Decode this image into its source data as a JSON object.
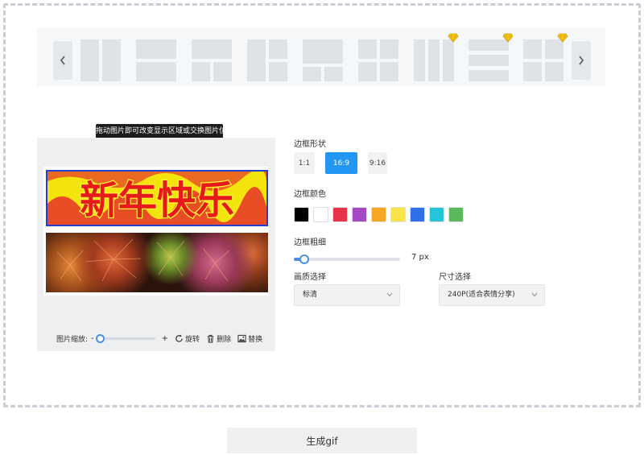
{
  "tooltip": "拖动图片即可改变显示区域或交换图片位置",
  "layouts": [
    {
      "id": "two-vertical",
      "vip": false
    },
    {
      "id": "two-horizontal",
      "vip": false
    },
    {
      "id": "one-top-two-bottom",
      "vip": false
    },
    {
      "id": "left-one-right-two",
      "vip": false
    },
    {
      "id": "top-one-bottom-two-wide",
      "vip": false
    },
    {
      "id": "top-two-bottom-one",
      "vip": false
    },
    {
      "id": "three-columns",
      "vip": true
    },
    {
      "id": "three-rows",
      "vip": true
    },
    {
      "id": "four-grid",
      "vip": true
    }
  ],
  "preview": {
    "banner_text": "新年快乐",
    "zoom_label": "图片缩放:",
    "zoom_minus": "-",
    "zoom_plus": "+",
    "zoom_level": 0,
    "rotate_label": "旋转",
    "delete_label": "删除",
    "replace_label": "替换"
  },
  "border_shape": {
    "label": "边框形状",
    "options": [
      "1:1",
      "16:9",
      "9:16"
    ],
    "selected": "16:9"
  },
  "border_color": {
    "label": "边框颜色",
    "colors": [
      "#000000",
      "#ffffff",
      "#e8334a",
      "#a548c4",
      "#f5a623",
      "#f8e34a",
      "#2f6fea",
      "#27c4d9",
      "#5cb85c"
    ]
  },
  "border_thickness": {
    "label": "边框粗细",
    "value": 7,
    "min": 0,
    "max": 100,
    "display": "7  px"
  },
  "quality": {
    "label": "画质选择",
    "selected": "标清"
  },
  "size": {
    "label": "尺寸选择",
    "selected": "240P(适合表情分享)"
  },
  "generate_label": "生成gif"
}
